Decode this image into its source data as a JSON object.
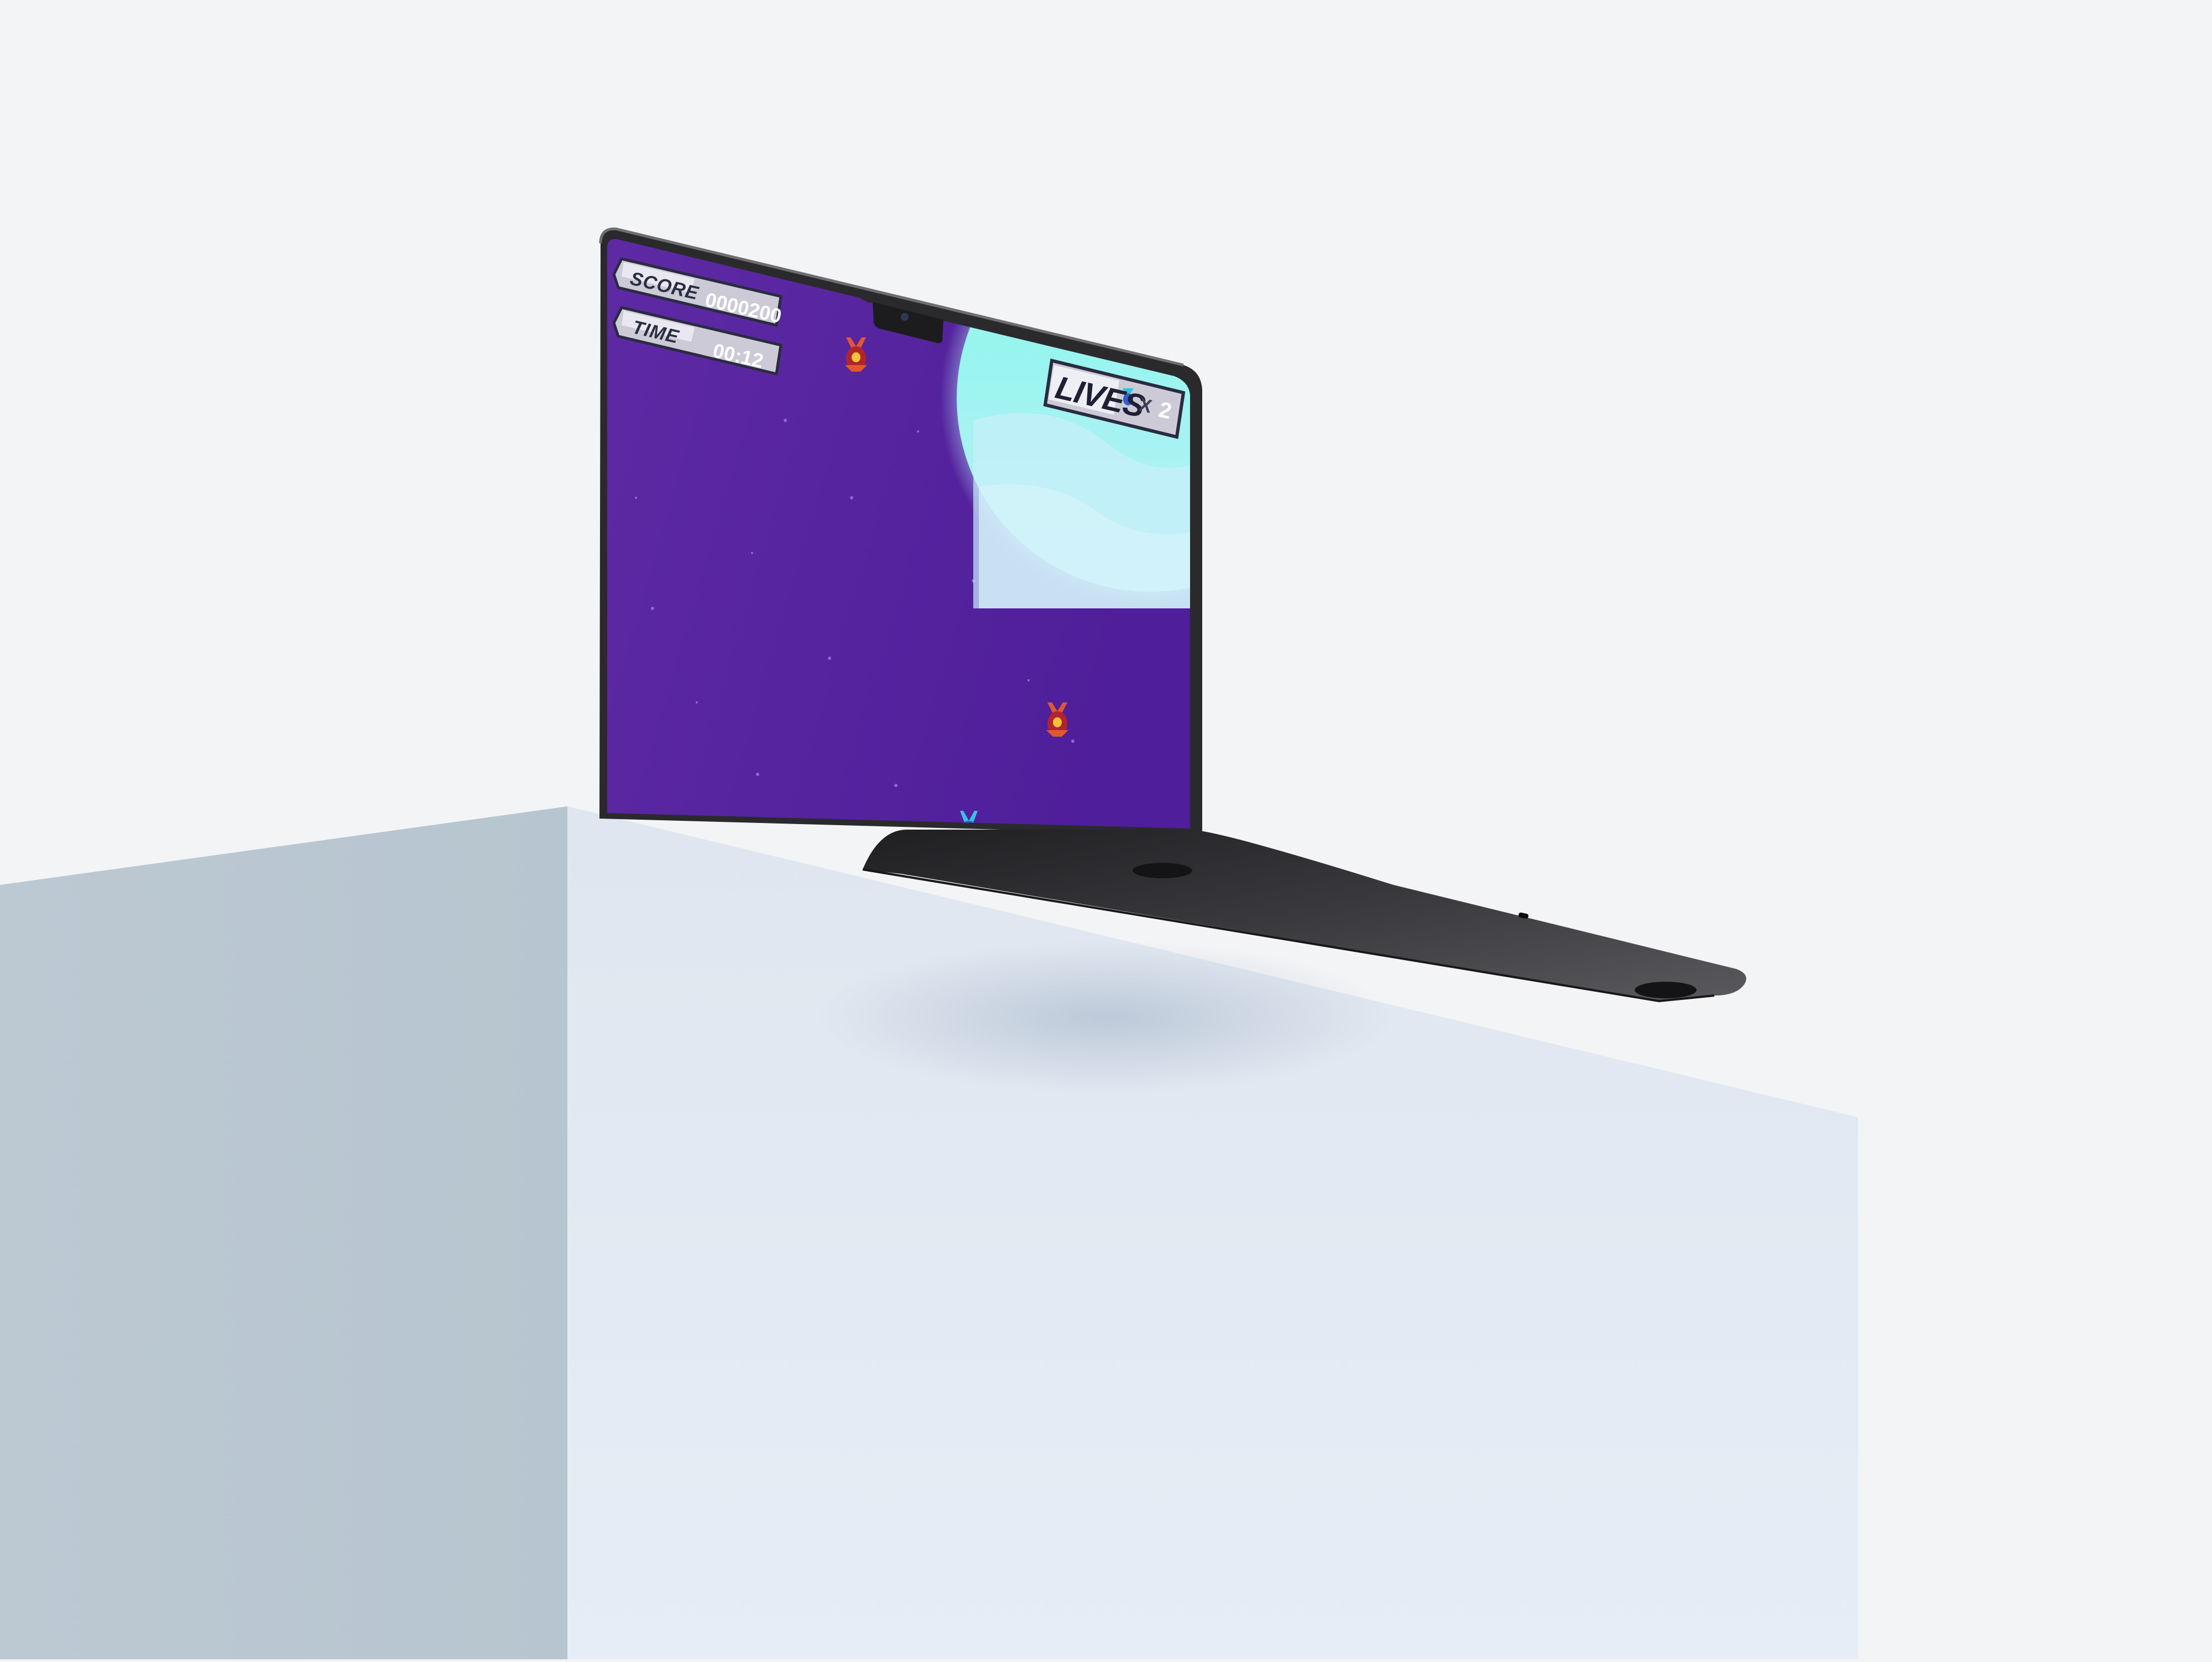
{
  "game": {
    "hud": {
      "score_label": "SCORE",
      "score_value": "0000200",
      "time_label": "TIME",
      "time_value": "00:12",
      "lives_label": "LIVES",
      "lives_multiplier": "X",
      "lives_count": "2"
    },
    "enemies": [
      {
        "name": "red-enemy-ship",
        "state": "active"
      },
      {
        "name": "red-enemy-ship",
        "state": "active"
      }
    ],
    "player": {
      "name": "blue-player-ship"
    },
    "background": {
      "planet": "cyan-planet",
      "sky": "purple-starfield"
    }
  },
  "colors": {
    "sky": "#55239e",
    "planet": "#a9f3f0",
    "hud_plate": "#c9c8d4",
    "device": "#2b2b2d",
    "pedestal_light": "#e4ebf4",
    "pedestal_dark": "#bac7d2",
    "background": "#f3f4f6"
  }
}
